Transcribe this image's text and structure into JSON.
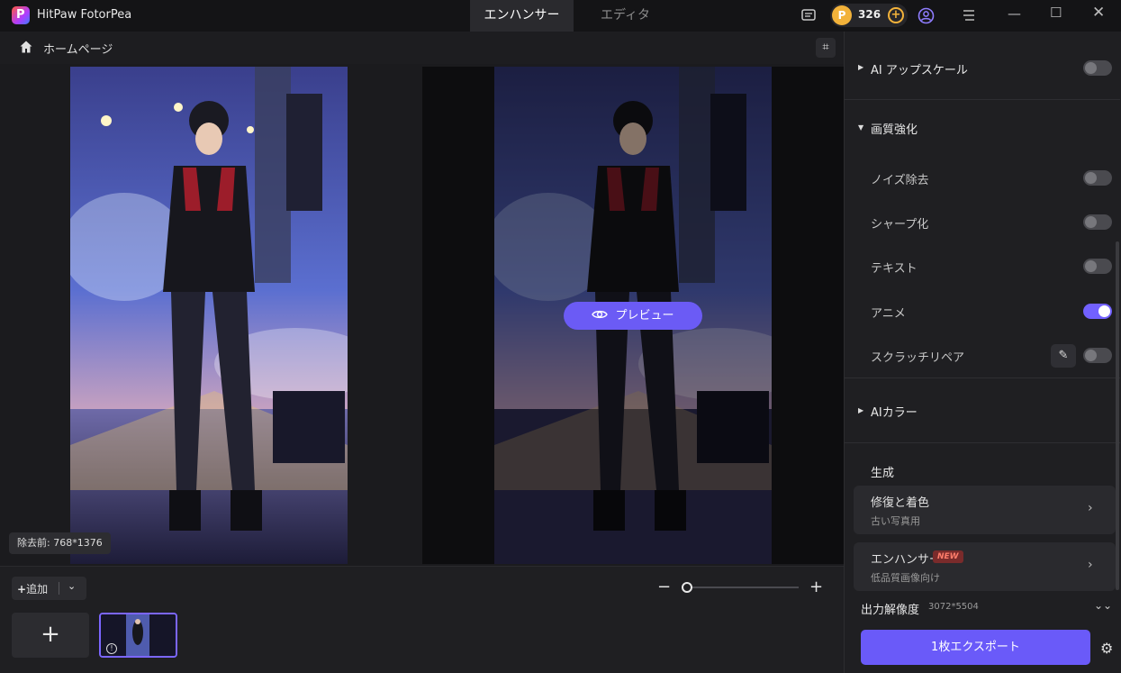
{
  "app": {
    "title": "HitPaw FotorPea"
  },
  "tabs": [
    {
      "label": "エンハンサー"
    },
    {
      "label": "エディタ"
    }
  ],
  "credits": {
    "count": "326"
  },
  "nav": {
    "home_label": "ホームページ"
  },
  "canvas": {
    "preview_label": "プレビュー",
    "dims_label": "除去前: 768*1376"
  },
  "bottom": {
    "add_label": "追加"
  },
  "sidebar": {
    "upscale_label": "AI アップスケール",
    "quality_section": "画質強化",
    "noise_label": "ノイズ除去",
    "sharpen_label": "シャープ化",
    "text_label": "テキスト",
    "anime_label": "アニメ",
    "scratch_label": "スクラッチリペア",
    "ai_color_label": "AIカラー",
    "generate_label": "生成",
    "cards": [
      {
        "title": "修復と着色",
        "subtitle": "古い写真用"
      },
      {
        "title": "エンハンサー",
        "badge": "NEW",
        "subtitle": "低品質画像向け"
      }
    ],
    "resolution_label": "出力解像度",
    "resolution_value": "3072*5504",
    "export_label": "1枚エクスポート"
  },
  "toggles": {
    "upscale": false,
    "noise": false,
    "sharpen": false,
    "text": false,
    "anime": true,
    "scratch": false
  },
  "colors": {
    "accent": "#6a5af9",
    "coin": "#f2b23a",
    "new_badge": "#ff7d6b"
  }
}
